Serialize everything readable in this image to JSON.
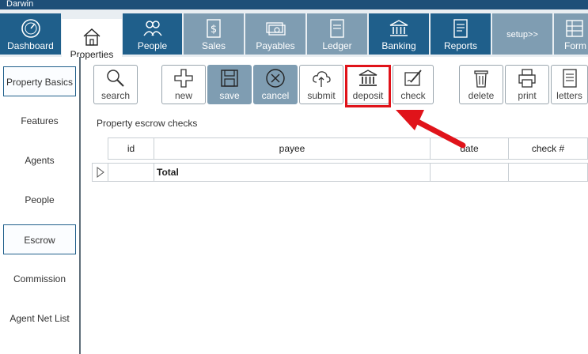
{
  "window": {
    "title": "Darwin"
  },
  "nav": {
    "items": [
      {
        "label": "Dashboard",
        "icon": "dashboard-gauge-icon",
        "state": "dark"
      },
      {
        "label": "Properties",
        "icon": "house-icon",
        "state": "active"
      },
      {
        "label": "People",
        "icon": "people-icon",
        "state": "dark"
      },
      {
        "label": "Sales",
        "icon": "dollar-document-icon",
        "state": "light"
      },
      {
        "label": "Payables",
        "icon": "money-bills-icon",
        "state": "light"
      },
      {
        "label": "Ledger",
        "icon": "ledger-book-icon",
        "state": "light"
      },
      {
        "label": "Banking",
        "icon": "bank-icon",
        "state": "dark"
      },
      {
        "label": "Reports",
        "icon": "report-document-icon",
        "state": "dark"
      },
      {
        "label": "setup>>",
        "icon": "",
        "state": "light"
      },
      {
        "label": "Form",
        "icon": "form-grid-icon",
        "state": "light"
      }
    ]
  },
  "sidebar": {
    "items": [
      {
        "label": "Property Basics",
        "selected": true
      },
      {
        "label": "Features",
        "selected": false
      },
      {
        "label": "Agents",
        "selected": false
      },
      {
        "label": "People",
        "selected": false
      },
      {
        "label": "Escrow",
        "selected": true
      },
      {
        "label": "Commission",
        "selected": false
      },
      {
        "label": "Agent Net List",
        "selected": false
      }
    ]
  },
  "toolbar": {
    "search": "search",
    "new": "new",
    "save": "save",
    "cancel": "cancel",
    "submit": "submit",
    "deposit": "deposit",
    "check": "check",
    "delete": "delete",
    "print": "print",
    "letters": "letters"
  },
  "main": {
    "section_title": "Property escrow checks",
    "table": {
      "columns": [
        "id",
        "payee",
        "date",
        "check #"
      ],
      "rows": [
        {
          "id": "",
          "payee": "Total",
          "date": "",
          "check": ""
        }
      ]
    }
  },
  "colors": {
    "titlebar": "#1e4f78",
    "nav_dark": "#1f5f8b",
    "nav_light": "#7f9db2",
    "highlight_red": "#e0131a"
  }
}
